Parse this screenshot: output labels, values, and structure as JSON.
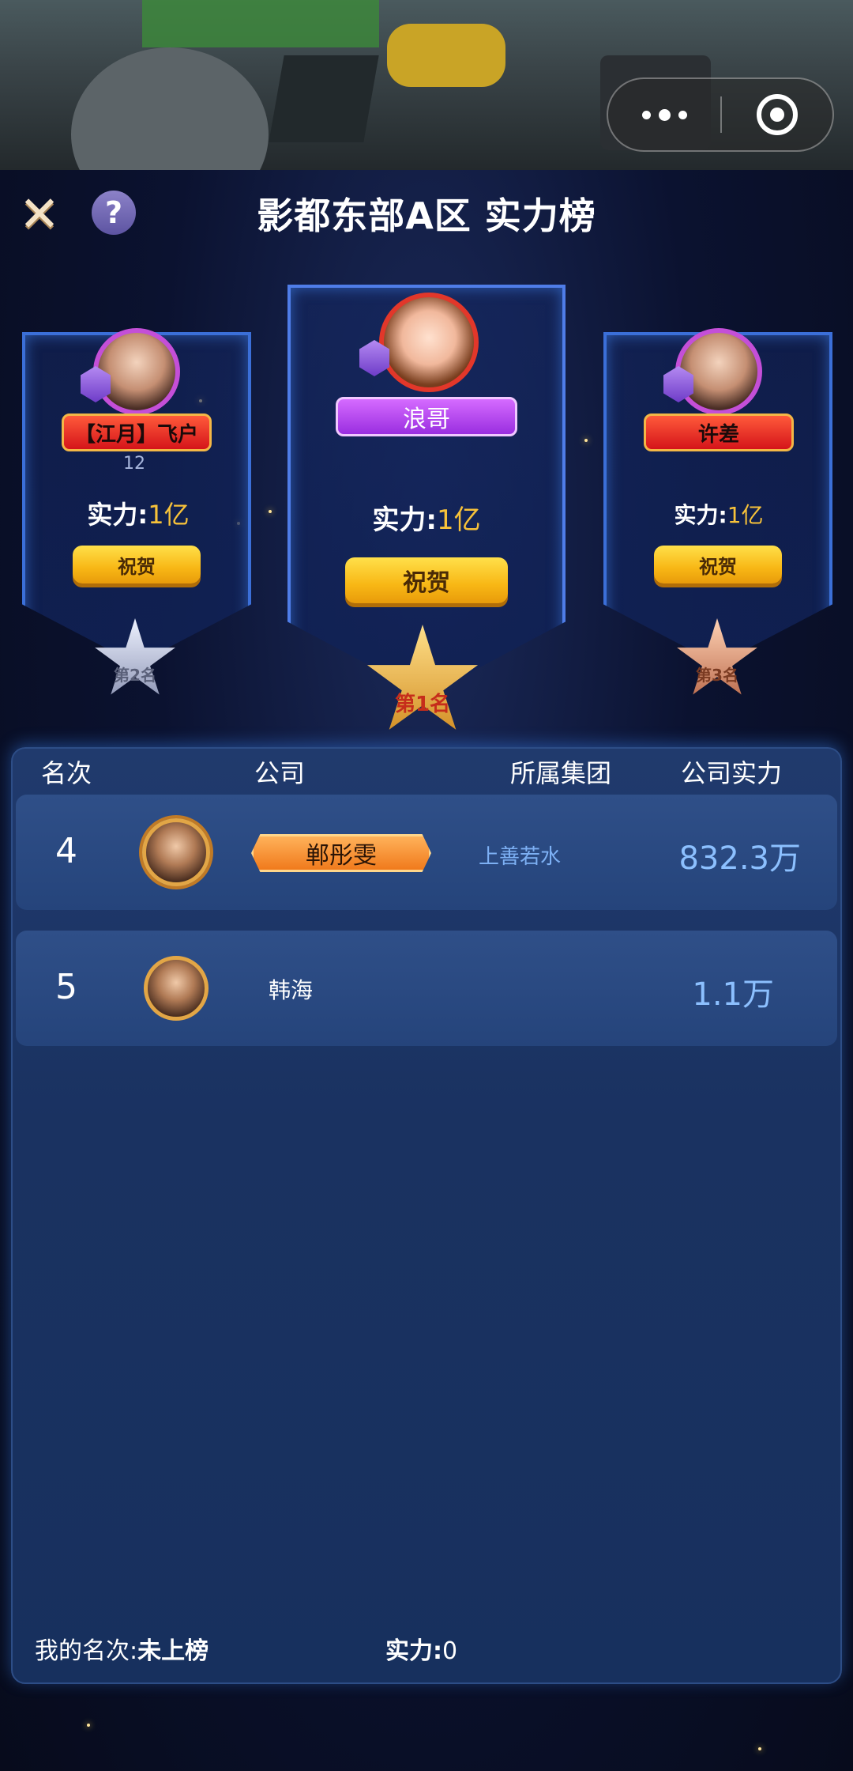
{
  "capsule": {
    "more_icon": "more-dots-icon",
    "target_icon": "target-icon"
  },
  "header": {
    "close_icon": "close-icon",
    "help_label": "?",
    "title": "影都东部A区 实力榜"
  },
  "podium": {
    "first": {
      "name": "浪哥",
      "power_label": "实力:",
      "power_value": "1亿",
      "congrats": "祝贺",
      "medal": "第1名",
      "medal_num": "1"
    },
    "second": {
      "name": "【江月】飞户",
      "level": "12",
      "power_label": "实力:",
      "power_value": "1亿",
      "congrats": "祝贺",
      "medal": "第2名",
      "medal_num": "2"
    },
    "third": {
      "name": "许差",
      "power_label": "实力:",
      "power_value": "1亿",
      "congrats": "祝贺",
      "medal": "第3名",
      "medal_num": "3"
    }
  },
  "table": {
    "headers": [
      "名次",
      "公司",
      "所属集团",
      "公司实力"
    ],
    "rows": [
      {
        "rank": "4",
        "company": "郸彤雯",
        "group": "上善若水",
        "power": "832.3万"
      },
      {
        "rank": "5",
        "company": "韩海",
        "group": "",
        "power": "1.1万"
      }
    ]
  },
  "footer": {
    "my_rank_label": "我的名次:",
    "my_rank_value": "未上榜",
    "power_label": "实力:",
    "power_value": "0"
  },
  "colors": {
    "accent_gold": "#f7c23a",
    "power_blue": "#8cc0ff",
    "card_border": "#3b6fd8"
  }
}
